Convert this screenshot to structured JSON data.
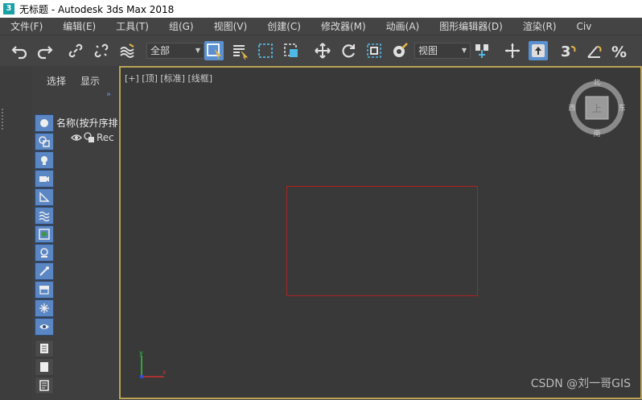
{
  "window": {
    "title": "无标题 - Autodesk 3ds Max 2018",
    "app_icon_glyph": "3"
  },
  "menu": [
    "文件(F)",
    "编辑(E)",
    "工具(T)",
    "组(G)",
    "视图(V)",
    "创建(C)",
    "修改器(M)",
    "动画(A)",
    "图形编辑器(D)",
    "渲染(R)",
    "Civ"
  ],
  "toolbar": {
    "selection_filter": "全部",
    "reference_coord": "视图"
  },
  "scene_explorer": {
    "tabs": [
      "选择",
      "显示"
    ],
    "expand_glyph": "»",
    "column_header": "名称(按升序排",
    "row_label": "Rec"
  },
  "viewport": {
    "label": "[+] [顶] [标准] [线框]",
    "viewcube": {
      "north": "北",
      "south": "南",
      "east": "东",
      "west": "西",
      "face": "上"
    },
    "axis": {
      "y": "y",
      "x": "x"
    }
  },
  "watermark": "CSDN @刘一哥GIS",
  "colors": {
    "accent": "#5a8fd0",
    "viewport_border": "#b9a354",
    "selection_rect": "#b02020"
  }
}
